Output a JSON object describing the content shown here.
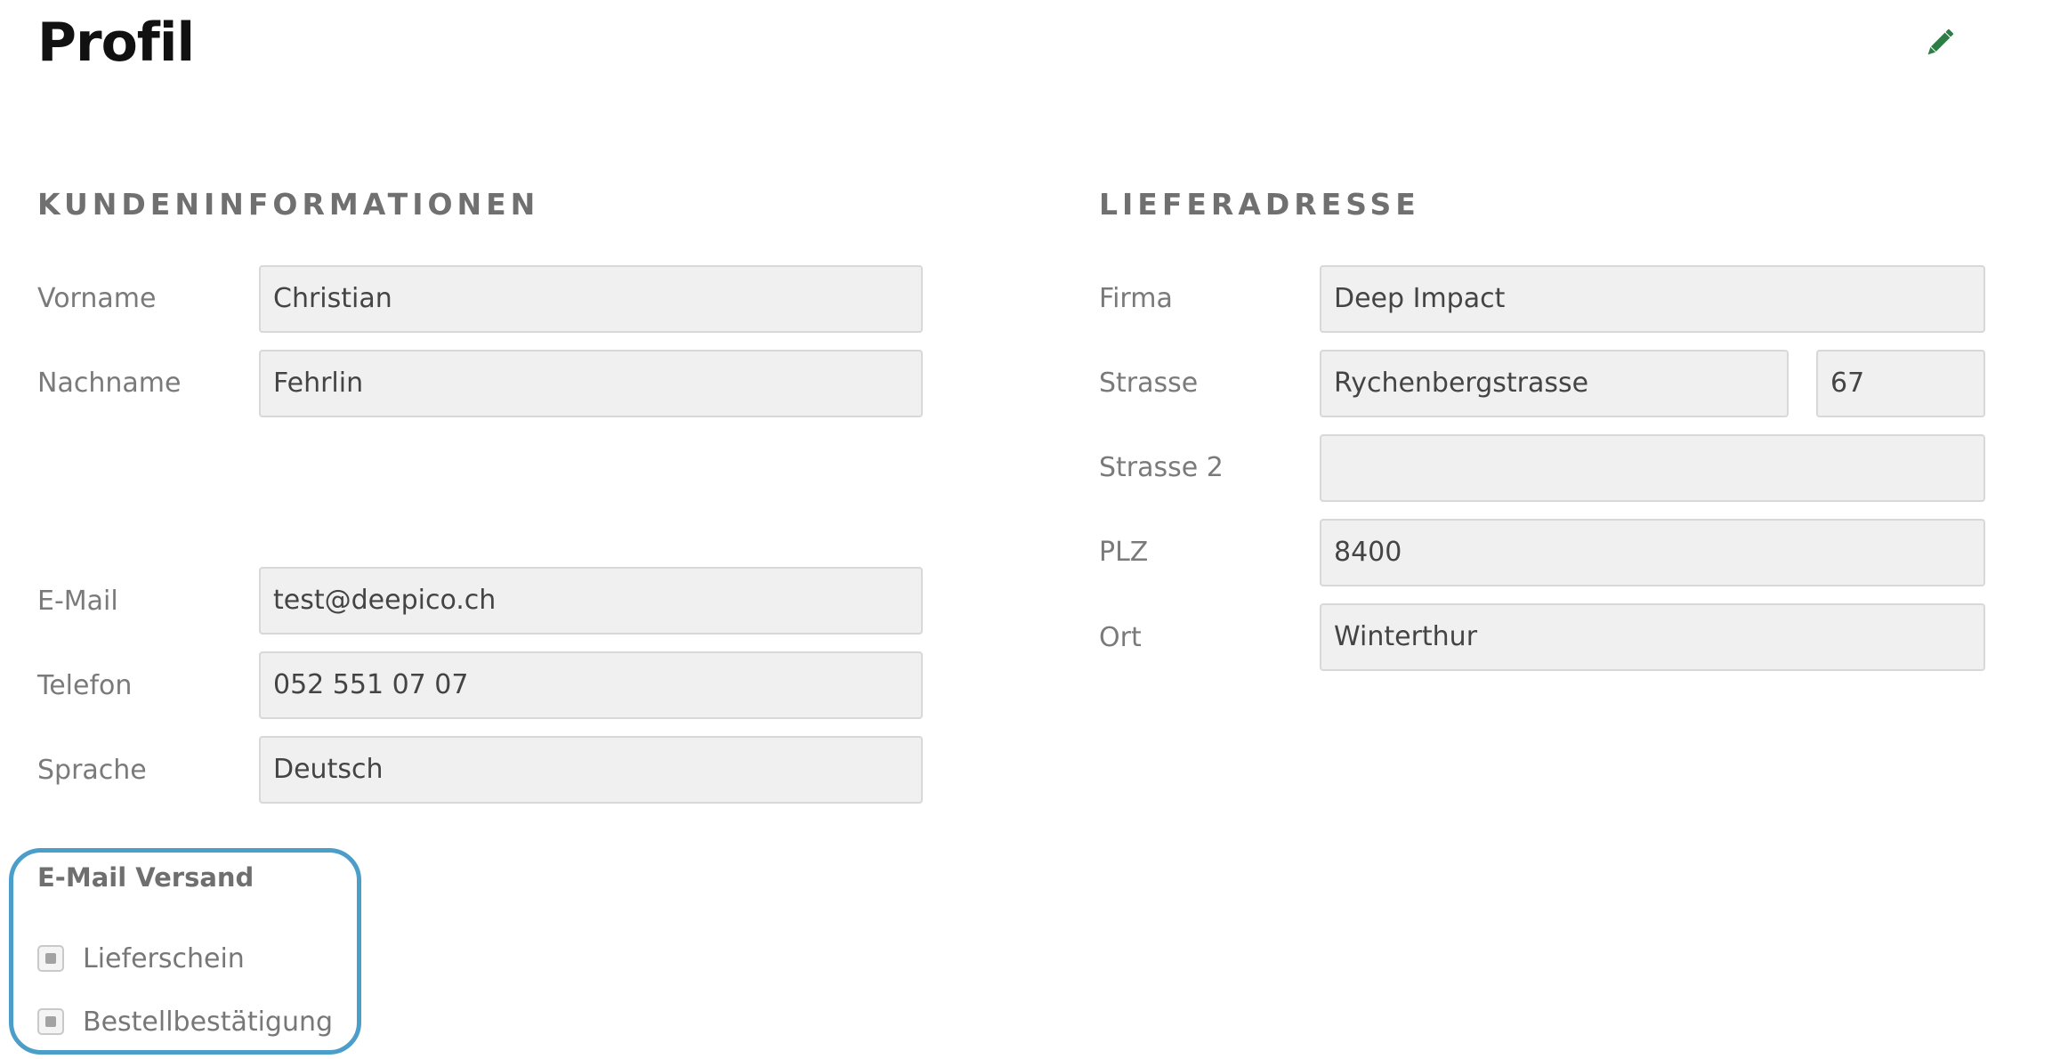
{
  "header": {
    "title": "Profil",
    "edit_icon": "pencil-icon",
    "accent_color": "#2e7d46"
  },
  "customer_info": {
    "heading": "KUNDENINFORMATIONEN",
    "first_name": {
      "label": "Vorname",
      "value": "Christian"
    },
    "last_name": {
      "label": "Nachname",
      "value": "Fehrlin"
    },
    "email": {
      "label": "E-Mail",
      "value": "test@deepico.ch"
    },
    "phone": {
      "label": "Telefon",
      "value": "052 551 07 07"
    },
    "language": {
      "label": "Sprache",
      "value": "Deutsch"
    }
  },
  "delivery_address": {
    "heading": "LIEFERADRESSE",
    "company": {
      "label": "Firma",
      "value": "Deep Impact"
    },
    "street": {
      "label": "Strasse",
      "value": "Rychenbergstrasse",
      "number": "67"
    },
    "street2": {
      "label": "Strasse 2",
      "value": ""
    },
    "zip": {
      "label": "PLZ",
      "value": "8400"
    },
    "city": {
      "label": "Ort",
      "value": "Winterthur"
    }
  },
  "email_dispatch": {
    "title": "E-Mail Versand",
    "highlight_color": "#4a9ec9",
    "options": [
      {
        "label": "Lieferschein",
        "checked": true
      },
      {
        "label": "Bestellbestätigung",
        "checked": true
      }
    ]
  }
}
